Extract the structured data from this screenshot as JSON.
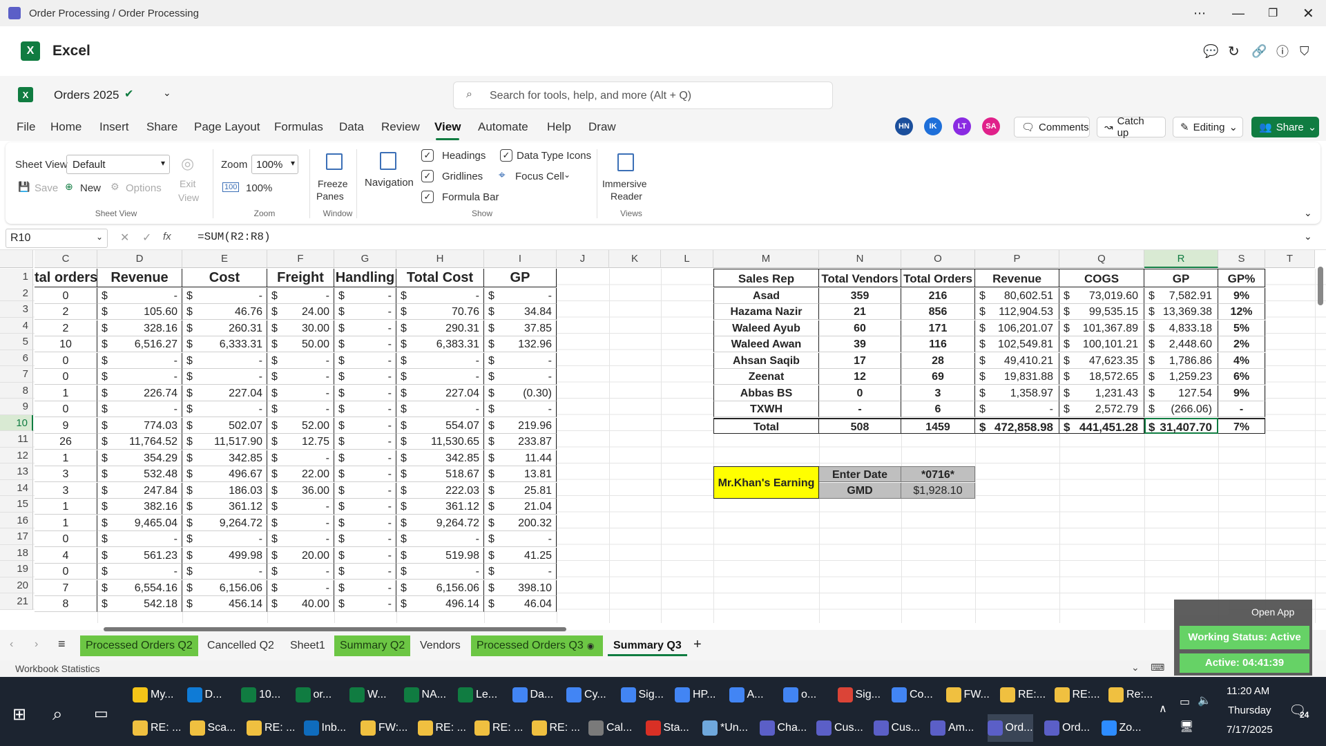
{
  "window": {
    "title": "Order Processing / Order Processing"
  },
  "app": {
    "name": "Excel"
  },
  "doc": {
    "name": "Orders 2025",
    "search_placeholder": "Search for tools, help, and more (Alt + Q)"
  },
  "menu": [
    "File",
    "Home",
    "Insert",
    "Share",
    "Page Layout",
    "Formulas",
    "Data",
    "Review",
    "View",
    "Automate",
    "Help",
    "Draw"
  ],
  "active_menu": "View",
  "avatars": [
    {
      "initials": "HN",
      "color": "#1b4f9c"
    },
    {
      "initials": "IK",
      "color": "#1e6fd9"
    },
    {
      "initials": "LT",
      "color": "#8a2be2"
    },
    {
      "initials": "SA",
      "color": "#e0218a"
    }
  ],
  "buttons": {
    "comments": "Comments",
    "catchup": "Catch up",
    "editing": "Editing",
    "share": "Share"
  },
  "ribbon": {
    "sheet_view_label": "Sheet View",
    "sheet_view_value": "Default",
    "save": "Save",
    "new": "New",
    "options": "Options",
    "exit": "Exit",
    "view": "View",
    "group_sheetview": "Sheet View",
    "zoom_label": "Zoom",
    "zoom_value": "100%",
    "zoom100": "100%",
    "group_zoom": "Zoom",
    "freeze": "Freeze",
    "panes": "Panes",
    "group_window": "Window",
    "navigation": "Navigation",
    "headings": "Headings",
    "gridlines": "Gridlines",
    "formula_bar": "Formula Bar",
    "data_type_icons": "Data Type Icons",
    "focus_cell": "Focus Cell",
    "group_show": "Show",
    "immersive": "Immersive",
    "reader": "Reader",
    "group_views": "Views"
  },
  "formula": {
    "namebox": "R10",
    "fx": "fx",
    "text": "=SUM(R2:R8)"
  },
  "columns": [
    "C",
    "D",
    "E",
    "F",
    "G",
    "H",
    "I",
    "J",
    "K",
    "L",
    "M",
    "N",
    "O",
    "P",
    "Q",
    "R",
    "S",
    "T"
  ],
  "rows": [
    "1",
    "2",
    "3",
    "4",
    "5",
    "6",
    "7",
    "8",
    "9",
    "10",
    "11",
    "12",
    "13",
    "14",
    "15",
    "16",
    "17",
    "18",
    "19",
    "20",
    "21"
  ],
  "left_table": {
    "headers": [
      "tal orders",
      "Revenue",
      "Cost",
      "Freight",
      "Handling",
      "Total Cost",
      "GP"
    ],
    "rows": [
      [
        "0",
        "-",
        "-",
        "-",
        "-",
        "-",
        "-"
      ],
      [
        "2",
        "105.60",
        "46.76",
        "24.00",
        "-",
        "70.76",
        "34.84"
      ],
      [
        "2",
        "328.16",
        "260.31",
        "30.00",
        "-",
        "290.31",
        "37.85"
      ],
      [
        "10",
        "6,516.27",
        "6,333.31",
        "50.00",
        "-",
        "6,383.31",
        "132.96"
      ],
      [
        "0",
        "-",
        "-",
        "-",
        "-",
        "-",
        "-"
      ],
      [
        "0",
        "-",
        "-",
        "-",
        "-",
        "-",
        "-"
      ],
      [
        "1",
        "226.74",
        "227.04",
        "-",
        "-",
        "227.04",
        "(0.30)"
      ],
      [
        "0",
        "-",
        "-",
        "-",
        "-",
        "-",
        "-"
      ],
      [
        "9",
        "774.03",
        "502.07",
        "52.00",
        "-",
        "554.07",
        "219.96"
      ],
      [
        "26",
        "11,764.52",
        "11,517.90",
        "12.75",
        "-",
        "11,530.65",
        "233.87"
      ],
      [
        "1",
        "354.29",
        "342.85",
        "-",
        "-",
        "342.85",
        "11.44"
      ],
      [
        "3",
        "532.48",
        "496.67",
        "22.00",
        "-",
        "518.67",
        "13.81"
      ],
      [
        "3",
        "247.84",
        "186.03",
        "36.00",
        "-",
        "222.03",
        "25.81"
      ],
      [
        "1",
        "382.16",
        "361.12",
        "-",
        "-",
        "361.12",
        "21.04"
      ],
      [
        "1",
        "9,465.04",
        "9,264.72",
        "-",
        "-",
        "9,264.72",
        "200.32"
      ],
      [
        "0",
        "-",
        "-",
        "-",
        "-",
        "-",
        "-"
      ],
      [
        "4",
        "561.23",
        "499.98",
        "20.00",
        "-",
        "519.98",
        "41.25"
      ],
      [
        "0",
        "-",
        "-",
        "-",
        "-",
        "-",
        "-"
      ],
      [
        "7",
        "6,554.16",
        "6,156.06",
        "-",
        "-",
        "6,156.06",
        "398.10"
      ],
      [
        "8",
        "542.18",
        "456.14",
        "40.00",
        "-",
        "496.14",
        "46.04"
      ]
    ]
  },
  "right_table": {
    "headers": [
      "Sales Rep",
      "Total Vendors",
      "Total Orders",
      "Revenue",
      "COGS",
      "GP",
      "GP%"
    ],
    "rows": [
      [
        "Asad",
        "359",
        "216",
        "80,602.51",
        "73,019.60",
        "7,582.91",
        "9%"
      ],
      [
        "Hazama Nazir",
        "21",
        "856",
        "112,904.53",
        "99,535.15",
        "13,369.38",
        "12%"
      ],
      [
        "Waleed Ayub",
        "60",
        "171",
        "106,201.07",
        "101,367.89",
        "4,833.18",
        "5%"
      ],
      [
        "Waleed Awan",
        "39",
        "116",
        "102,549.81",
        "100,101.21",
        "2,448.60",
        "2%"
      ],
      [
        "Ahsan Saqib",
        "17",
        "28",
        "49,410.21",
        "47,623.35",
        "1,786.86",
        "4%"
      ],
      [
        "Zeenat",
        "12",
        "69",
        "19,831.88",
        "18,572.65",
        "1,259.23",
        "6%"
      ],
      [
        "Abbas BS",
        "0",
        "3",
        "1,358.97",
        "1,231.43",
        "127.54",
        "9%"
      ],
      [
        "TXWH",
        "-",
        "6",
        "-",
        "2,572.79",
        "(266.06)",
        "-"
      ]
    ],
    "total": [
      "Total",
      "508",
      "1459",
      "472,858.98",
      "441,451.28",
      "31,407.70",
      "7%"
    ]
  },
  "dollar": "$",
  "earning": {
    "title": "Mr.Khan's Earning",
    "enter_date": "Enter Date",
    "date_value": "*0716*",
    "gmd": "GMD",
    "gmd_value": "$1,928.10"
  },
  "sheets": [
    "Processed Orders Q2",
    "Cancelled Q2",
    "Sheet1",
    "Summary Q2",
    "Vendors",
    "Processed Orders Q3",
    "Summary Q3"
  ],
  "active_sheet": "Summary Q3",
  "status": {
    "left": "Workbook Statistics"
  },
  "overlay": {
    "open_app": "Open App",
    "working": "Working Status: Active",
    "active": "Active: 04:41:39"
  },
  "taskbar": {
    "row1": [
      "My...",
      "D...",
      "10...",
      "or...",
      "W...",
      "NA...",
      "Le...",
      "Da...",
      "Cy...",
      "Sig...",
      "HP...",
      "A...",
      "o...",
      "Sig...",
      "Co...",
      "FW...",
      "RE:...",
      "RE:...",
      "Re:..."
    ],
    "row2": [
      "RE: ...",
      "Sca...",
      "RE: ...",
      "Inb...",
      "FW:...",
      "RE: ...",
      "RE: ...",
      "RE: ...",
      "Cal...",
      "Sta...",
      "*Un...",
      "Cha...",
      "Cus...",
      "Cus...",
      "Am...",
      "Ord...",
      "Ord...",
      "Zo..."
    ],
    "time": "11:20 AM",
    "day": "Thursday",
    "date": "7/17/2025",
    "notif": "24"
  }
}
